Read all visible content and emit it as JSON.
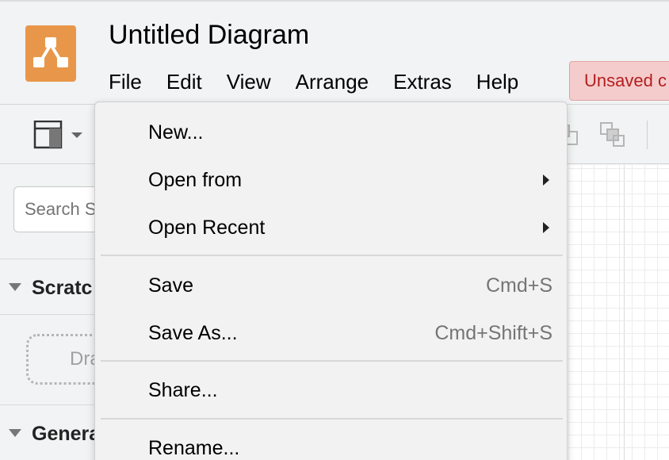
{
  "app": {
    "logo_icon": "drawio-logo-icon",
    "accent_color": "#e8974a"
  },
  "header": {
    "title": "Untitled Diagram",
    "menus": [
      "File",
      "Edit",
      "View",
      "Arrange",
      "Extras",
      "Help"
    ],
    "unsaved_badge": "Unsaved c"
  },
  "toolbar": {
    "icons": [
      "format-panel-icon",
      "chevron-down-icon",
      "to-back-icon",
      "duplicate-icon"
    ]
  },
  "sidebar": {
    "search_placeholder": "Search S",
    "sections": [
      {
        "label": "Scratc",
        "icon": "triangle-down-icon"
      },
      {
        "label": "Genera",
        "icon": "triangle-down-icon"
      }
    ],
    "drop_zone_label": "Dra"
  },
  "file_menu": {
    "items": [
      {
        "label": "New...",
        "shortcut": "",
        "submenu": false
      },
      {
        "label": "Open from",
        "shortcut": "",
        "submenu": true
      },
      {
        "label": "Open Recent",
        "shortcut": "",
        "submenu": true
      },
      {
        "label": "Save",
        "shortcut": "Cmd+S",
        "submenu": false
      },
      {
        "label": "Save As...",
        "shortcut": "Cmd+Shift+S",
        "submenu": false
      },
      {
        "label": "Share...",
        "shortcut": "",
        "submenu": false
      },
      {
        "label": "Rename...",
        "shortcut": "",
        "submenu": false
      }
    ]
  }
}
